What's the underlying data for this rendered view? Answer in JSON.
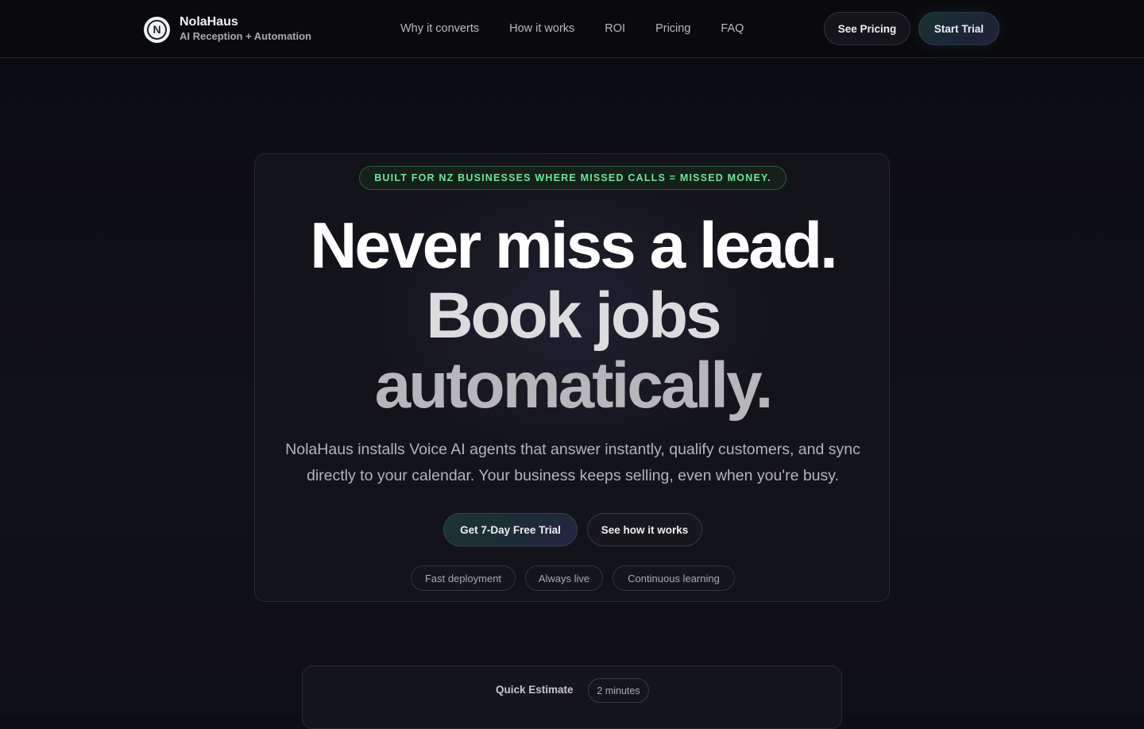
{
  "brand": {
    "logo_letter": "N",
    "name": "NolaHaus",
    "tagline": "AI Reception + Automation"
  },
  "nav": {
    "items": [
      "Why it converts",
      "How it works",
      "ROI",
      "Pricing",
      "FAQ"
    ],
    "see_pricing": "See Pricing",
    "start_trial": "Start Trial"
  },
  "hero": {
    "tag": "BUILT FOR NZ BUSINESSES WHERE MISSED CALLS = MISSED MONEY.",
    "headline_line1": "Never miss a lead.",
    "headline_line2": "Book jobs",
    "headline_line3": "automatically.",
    "lead": "NolaHaus installs Voice AI agents that answer instantly, qualify customers, and sync directly to your calendar. Your business keeps selling, even when you're busy.",
    "cta_primary": "Get 7-Day Free Trial",
    "cta_secondary": "See how it works",
    "chips": [
      "Fast deployment",
      "Always live",
      "Continuous learning"
    ]
  },
  "estimate": {
    "title": "Quick Estimate",
    "badge": "2 minutes"
  },
  "colors": {
    "background": "#0d0e13",
    "accent_green": "#6fe59a",
    "card": "#14151a"
  }
}
